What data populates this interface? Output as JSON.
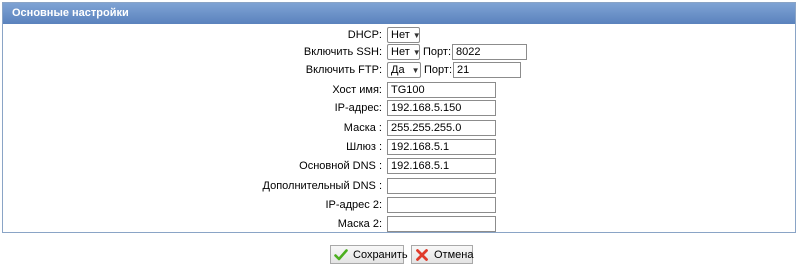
{
  "panel": {
    "title": "Основные настройки"
  },
  "form": {
    "dhcp": {
      "label": "DHCP:",
      "value": "Нет"
    },
    "ssh": {
      "label": "Включить SSH:",
      "value": "Нет",
      "port_label": "Порт:",
      "port": "8022"
    },
    "ftp": {
      "label": "Включить FTP:",
      "value": "Да",
      "port_label": "Порт:",
      "port": "21"
    },
    "hostname": {
      "label": "Хост имя:",
      "value": "TG100"
    },
    "ip": {
      "label": "IP-адрес:",
      "value": "192.168.5.150"
    },
    "mask": {
      "label": "Маска :",
      "value": "255.255.255.0"
    },
    "gateway": {
      "label": "Шлюз :",
      "value": "192.168.5.1"
    },
    "dns_primary": {
      "label": "Основной DNS :",
      "value": "192.168.5.1"
    },
    "dns_secondary": {
      "label": "Дополнительный DNS :",
      "value": ""
    },
    "ip2": {
      "label": "IP-адрес 2:",
      "value": ""
    },
    "mask2": {
      "label": "Маска 2:",
      "value": ""
    }
  },
  "buttons": {
    "save": "Сохранить",
    "cancel": "Отмена"
  },
  "icons": {
    "save": "checkmark-icon",
    "cancel": "cross-icon"
  },
  "colors": {
    "header": "#6a8fc7",
    "save_icon": "#4caf1f",
    "cancel_icon": "#e03a2a"
  }
}
